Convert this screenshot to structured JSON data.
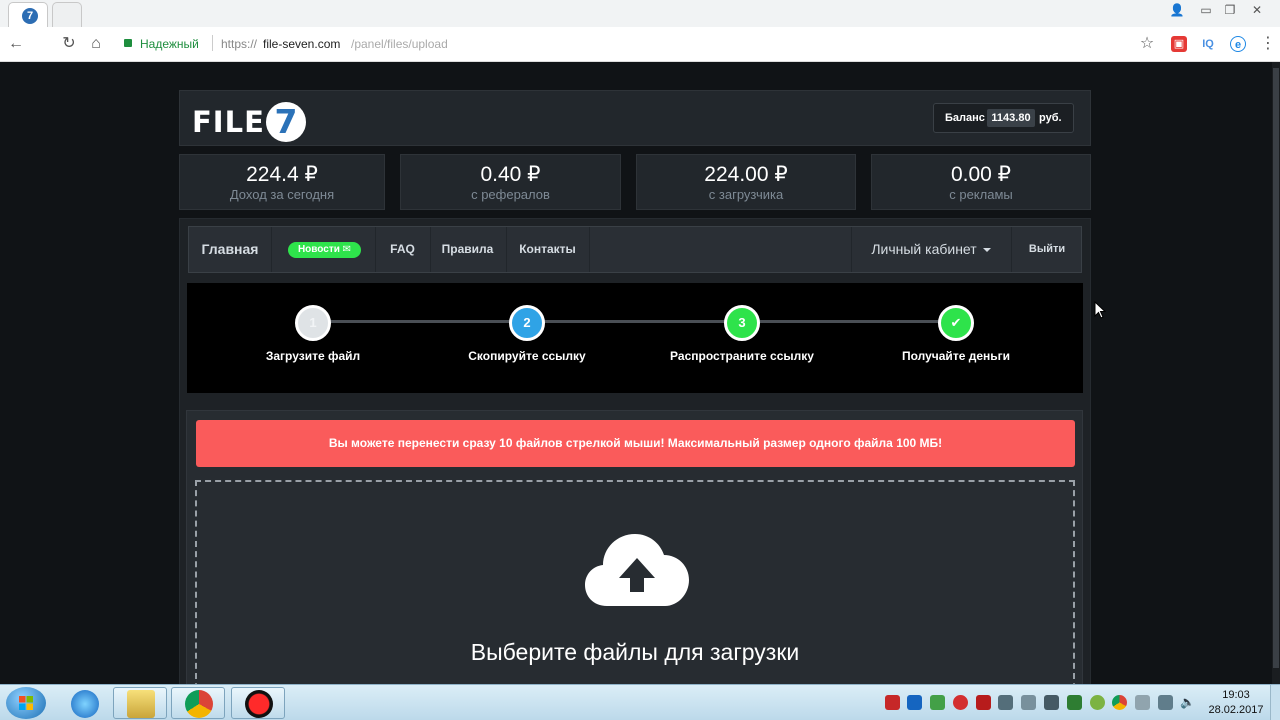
{
  "browser": {
    "tab_favicon": "7",
    "url": {
      "secure_label": "Надежный",
      "scheme": "https://",
      "host": "file-seven.com",
      "path": "/panel/files/upload"
    },
    "extensions": [
      {
        "name": "extension-red",
        "glyph": "▣",
        "color": "#e53935"
      },
      {
        "name": "extension-iq",
        "glyph": "IQ",
        "color": "#4a90e2"
      },
      {
        "name": "extension-e",
        "glyph": "e",
        "color": "#1e88e5"
      }
    ]
  },
  "site": {
    "logo_text": "FILE-",
    "logo_digit": "7",
    "balance": {
      "label": "Баланс",
      "value": "1143.80",
      "unit": "руб."
    },
    "stats": [
      {
        "value": "224.4 ₽",
        "label": "Доход за сегодня"
      },
      {
        "value": "0.40 ₽",
        "label": "с рефералов"
      },
      {
        "value": "224.00 ₽",
        "label": "с загрузчика"
      },
      {
        "value": "0.00 ₽",
        "label": "с рекламы"
      }
    ],
    "nav": {
      "home": "Главная",
      "news": "Новости ✉",
      "faq": "FAQ",
      "rules": "Правила",
      "contacts": "Контакты",
      "account": "Личный кабинет",
      "logout": "Выйти"
    },
    "steps": [
      {
        "number": "1",
        "label": "Загрузите файл",
        "color": "#dfe3e6"
      },
      {
        "number": "2",
        "label": "Скопируйте ссылку",
        "color": "#2fa3e6"
      },
      {
        "number": "3",
        "label": "Распространите ссылку",
        "color": "#2ee34b"
      },
      {
        "number": "✔",
        "label": "Получайте деньги",
        "color": "#2ee34b"
      }
    ],
    "alert": "Вы можете перенести сразу 10 файлов стрелкой мыши! Максимальный размер одного файла 100 МБ!",
    "dropzone_title": "Выберите файлы для загрузки"
  },
  "taskbar": {
    "time": "19:03",
    "date": "28.02.2017"
  },
  "colors": {
    "accent_green": "#2ee34b",
    "accent_blue": "#2fa3e6",
    "alert_red": "#fa5b5b",
    "page_bg": "#101316"
  }
}
